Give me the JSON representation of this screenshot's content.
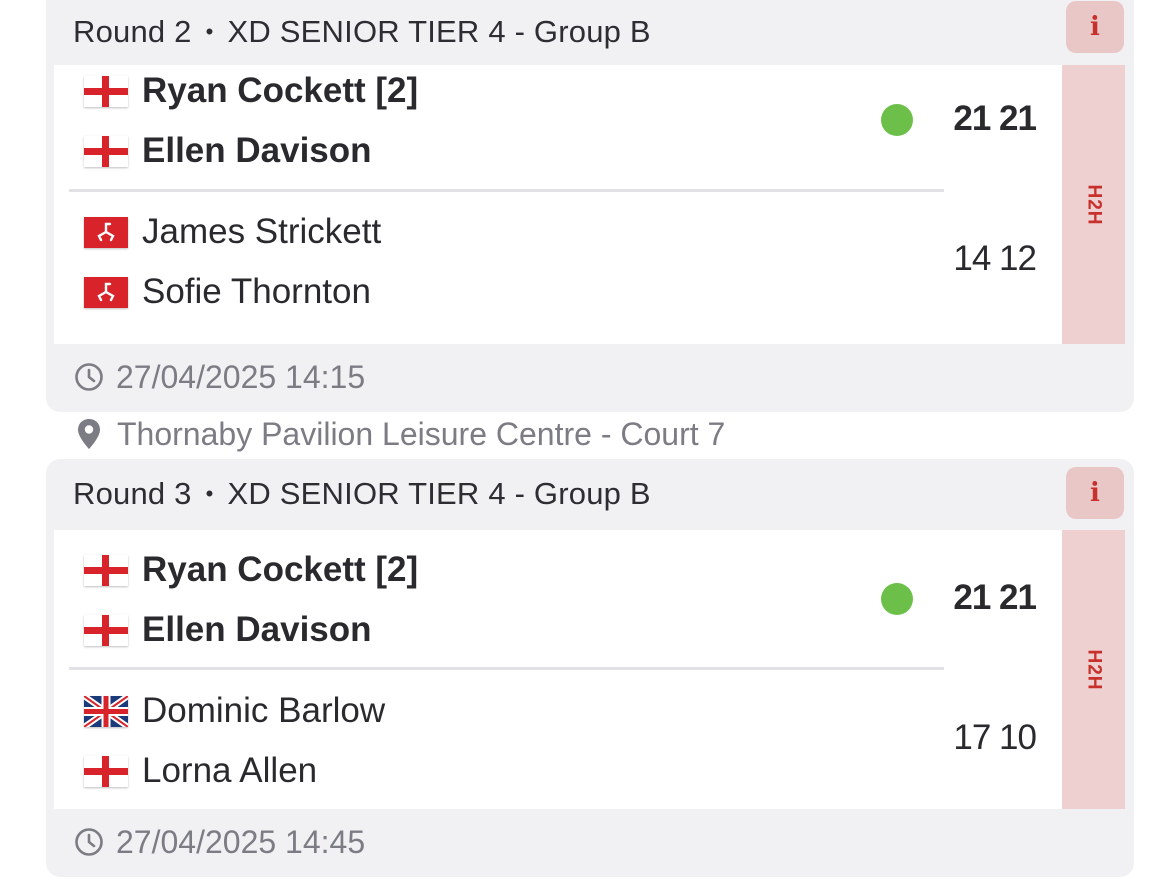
{
  "colors": {
    "accent_red": "#c8302c",
    "h2h_background": "#efd0d0",
    "live_dot": "#6cc049",
    "muted_text": "#7c7c85"
  },
  "matches": [
    {
      "round": "Round 2",
      "separator": "•",
      "event": "XD SENIOR TIER 4 - Group B",
      "info_icon": "info-icon",
      "info_label": "i",
      "h2h_label": "H2H",
      "team1": {
        "players": [
          {
            "flag": "england",
            "name": "Ryan Cockett [2]"
          },
          {
            "flag": "england",
            "name": "Ellen Davison"
          }
        ],
        "score": "21 21",
        "winner": true
      },
      "team2": {
        "players": [
          {
            "flag": "isle-of-man",
            "name": "James Strickett"
          },
          {
            "flag": "isle-of-man",
            "name": "Sofie Thornton"
          }
        ],
        "score": "14 12",
        "winner": false
      },
      "datetime": "27/04/2025 14:15"
    },
    {
      "round": "Round 3",
      "separator": "•",
      "event": "XD SENIOR TIER 4 - Group B",
      "info_icon": "info-icon",
      "info_label": "i",
      "h2h_label": "H2H",
      "team1": {
        "players": [
          {
            "flag": "england",
            "name": "Ryan Cockett [2]"
          },
          {
            "flag": "england",
            "name": "Ellen Davison"
          }
        ],
        "score": "21 21",
        "winner": true
      },
      "team2": {
        "players": [
          {
            "flag": "great-britain",
            "name": "Dominic Barlow"
          },
          {
            "flag": "england",
            "name": "Lorna Allen"
          }
        ],
        "score": "17 10",
        "winner": false
      },
      "datetime": "27/04/2025 14:45"
    }
  ],
  "venue": "Thornaby Pavilion Leisure Centre - Court 7"
}
